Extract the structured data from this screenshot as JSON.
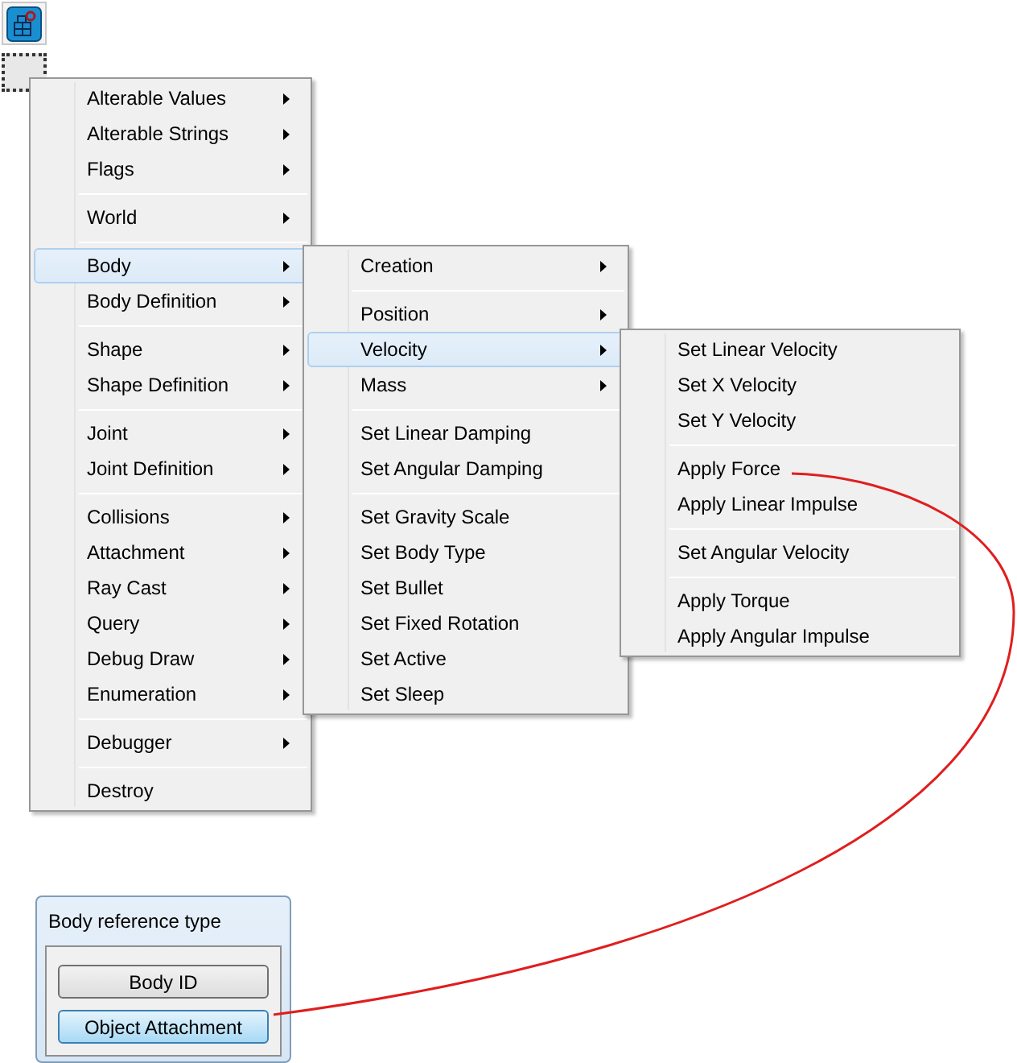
{
  "menus": [
    {
      "items": [
        {
          "kind": "item",
          "label": "Alterable Values",
          "submenu": true,
          "selected": false
        },
        {
          "kind": "item",
          "label": "Alterable Strings",
          "submenu": true,
          "selected": false
        },
        {
          "kind": "item",
          "label": "Flags",
          "submenu": true,
          "selected": false
        },
        {
          "kind": "separator"
        },
        {
          "kind": "item",
          "label": "World",
          "submenu": true,
          "selected": false
        },
        {
          "kind": "separator"
        },
        {
          "kind": "item",
          "label": "Body",
          "submenu": true,
          "selected": true
        },
        {
          "kind": "item",
          "label": "Body Definition",
          "submenu": true,
          "selected": false
        },
        {
          "kind": "separator"
        },
        {
          "kind": "item",
          "label": "Shape",
          "submenu": true,
          "selected": false
        },
        {
          "kind": "item",
          "label": "Shape Definition",
          "submenu": true,
          "selected": false
        },
        {
          "kind": "separator"
        },
        {
          "kind": "item",
          "label": "Joint",
          "submenu": true,
          "selected": false
        },
        {
          "kind": "item",
          "label": "Joint Definition",
          "submenu": true,
          "selected": false
        },
        {
          "kind": "separator"
        },
        {
          "kind": "item",
          "label": "Collisions",
          "submenu": true,
          "selected": false
        },
        {
          "kind": "item",
          "label": "Attachment",
          "submenu": true,
          "selected": false
        },
        {
          "kind": "item",
          "label": "Ray Cast",
          "submenu": true,
          "selected": false
        },
        {
          "kind": "item",
          "label": "Query",
          "submenu": true,
          "selected": false
        },
        {
          "kind": "item",
          "label": "Debug Draw",
          "submenu": true,
          "selected": false
        },
        {
          "kind": "item",
          "label": "Enumeration",
          "submenu": true,
          "selected": false
        },
        {
          "kind": "separator"
        },
        {
          "kind": "item",
          "label": "Debugger",
          "submenu": true,
          "selected": false
        },
        {
          "kind": "separator"
        },
        {
          "kind": "item",
          "label": "Destroy",
          "submenu": false,
          "selected": false
        }
      ]
    },
    {
      "items": [
        {
          "kind": "item",
          "label": "Creation",
          "submenu": true,
          "selected": false
        },
        {
          "kind": "separator"
        },
        {
          "kind": "item",
          "label": "Position",
          "submenu": true,
          "selected": false
        },
        {
          "kind": "item",
          "label": "Velocity",
          "submenu": true,
          "selected": true
        },
        {
          "kind": "item",
          "label": "Mass",
          "submenu": true,
          "selected": false
        },
        {
          "kind": "separator"
        },
        {
          "kind": "item",
          "label": "Set Linear Damping",
          "submenu": false,
          "selected": false
        },
        {
          "kind": "item",
          "label": "Set Angular Damping",
          "submenu": false,
          "selected": false
        },
        {
          "kind": "separator"
        },
        {
          "kind": "item",
          "label": "Set Gravity Scale",
          "submenu": false,
          "selected": false
        },
        {
          "kind": "item",
          "label": "Set Body Type",
          "submenu": false,
          "selected": false
        },
        {
          "kind": "item",
          "label": "Set Bullet",
          "submenu": false,
          "selected": false
        },
        {
          "kind": "item",
          "label": "Set Fixed Rotation",
          "submenu": false,
          "selected": false
        },
        {
          "kind": "item",
          "label": "Set Active",
          "submenu": false,
          "selected": false
        },
        {
          "kind": "item",
          "label": "Set Sleep",
          "submenu": false,
          "selected": false
        }
      ]
    },
    {
      "items": [
        {
          "kind": "item",
          "label": "Set Linear Velocity",
          "submenu": false,
          "selected": false
        },
        {
          "kind": "item",
          "label": "Set X Velocity",
          "submenu": false,
          "selected": false
        },
        {
          "kind": "item",
          "label": "Set Y Velocity",
          "submenu": false,
          "selected": false
        },
        {
          "kind": "separator"
        },
        {
          "kind": "item",
          "label": "Apply Force",
          "submenu": false,
          "selected": false
        },
        {
          "kind": "item",
          "label": "Apply Linear Impulse",
          "submenu": false,
          "selected": false
        },
        {
          "kind": "separator"
        },
        {
          "kind": "item",
          "label": "Set Angular Velocity",
          "submenu": false,
          "selected": false
        },
        {
          "kind": "separator"
        },
        {
          "kind": "item",
          "label": "Apply Torque",
          "submenu": false,
          "selected": false
        },
        {
          "kind": "item",
          "label": "Apply Angular Impulse",
          "submenu": false,
          "selected": false
        }
      ]
    }
  ],
  "dialog": {
    "title": "Body reference type",
    "buttons": [
      {
        "label": "Body ID",
        "selected": false
      },
      {
        "label": "Object Attachment",
        "selected": true
      }
    ]
  }
}
